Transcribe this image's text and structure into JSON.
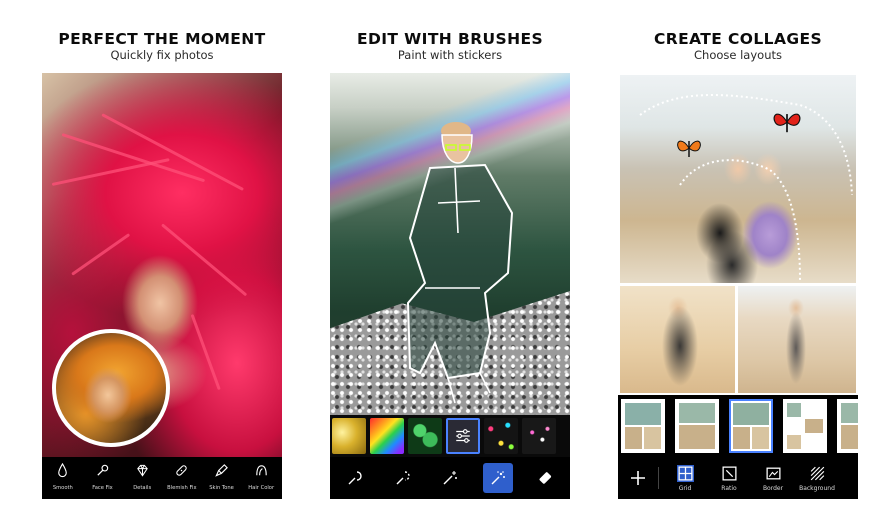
{
  "panels": [
    {
      "title": "PERFECT THE MOMENT",
      "subtitle": "Quickly fix photos"
    },
    {
      "title": "EDIT WITH BRUSHES",
      "subtitle": "Paint with stickers"
    },
    {
      "title": "CREATE COLLAGES",
      "subtitle": "Choose layouts"
    }
  ],
  "retouch_tools": [
    {
      "label": "Smooth",
      "icon": "drop-icon"
    },
    {
      "label": "Face Fix",
      "icon": "wand-icon"
    },
    {
      "label": "Details",
      "icon": "diamond-icon"
    },
    {
      "label": "Blemish Fix",
      "icon": "bandage-icon"
    },
    {
      "label": "Skin Tone",
      "icon": "brush-icon"
    },
    {
      "label": "Hair Color",
      "icon": "hair-icon"
    }
  ],
  "brush_tools": [
    {
      "icon": "magic-brush-icon",
      "active": false
    },
    {
      "icon": "dotted-brush-icon",
      "active": false
    },
    {
      "icon": "sparkle-wand-icon",
      "active": false
    },
    {
      "icon": "sticker-brush-icon",
      "active": true
    },
    {
      "icon": "eraser-icon",
      "active": false
    }
  ],
  "sticker_swatches": [
    {
      "color": "#d9b12c",
      "icon": "gold-glitter-swatch"
    },
    {
      "color": "#ff5a1f",
      "icon": "rainbow-swatch"
    },
    {
      "color": "#1f6b2a",
      "icon": "clover-swatch"
    },
    {
      "color": "#2a2a35",
      "icon": "settings-swatch",
      "selected": true
    },
    {
      "color": "#141414",
      "icon": "confetti-swatch"
    },
    {
      "color": "#181818",
      "icon": "sparkle-swatch"
    }
  ],
  "collage_tools": [
    {
      "label": "Grid",
      "icon": "grid-icon",
      "active": true
    },
    {
      "label": "Ratio",
      "icon": "ratio-icon",
      "active": false
    },
    {
      "label": "Border",
      "icon": "border-icon",
      "active": false
    },
    {
      "label": "Background",
      "icon": "background-icon",
      "active": false
    }
  ],
  "colors": {
    "accent": "#2f5fcc",
    "selection": "#4a82ff",
    "toolbar": "#000000"
  }
}
